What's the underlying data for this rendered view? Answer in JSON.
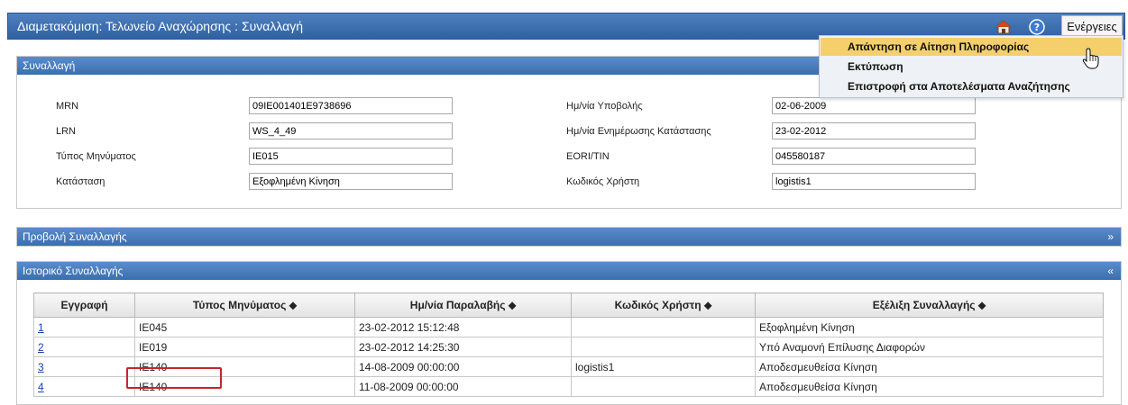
{
  "window": {
    "title": "Διαμετακόμιση: Τελωνείο Αναχώρησης : Συναλλαγή",
    "actions_label": "Ενέργειες",
    "icons": [
      "home-icon",
      "help-icon"
    ]
  },
  "menu": {
    "items": [
      {
        "label": "Απάντηση σε Αίτηση Πληροφορίας",
        "highlighted": true
      },
      {
        "label": "Εκτύπωση",
        "highlighted": false
      },
      {
        "label": "Επιστροφή στα Αποτελέσματα Αναζήτησης",
        "highlighted": false
      }
    ]
  },
  "transaction": {
    "header": "Συναλλαγή",
    "left": [
      {
        "label": "MRN",
        "value": "09IE001401E9738696"
      },
      {
        "label": "LRN",
        "value": "WS_4_49"
      },
      {
        "label": "Τύπος Μηνύματος",
        "value": "IE015"
      },
      {
        "label": "Κατάσταση",
        "value": "Εξοφλημένη Κίνηση"
      }
    ],
    "right": [
      {
        "label": "Ημ/νία Υποβολής",
        "value": "02-06-2009"
      },
      {
        "label": "Ημ/νία Ενημέρωσης Κατάστασης",
        "value": "23-02-2012"
      },
      {
        "label": "EORI/TIN",
        "value": "045580187"
      },
      {
        "label": "Κωδικός Χρήστη",
        "value": "logistis1"
      }
    ]
  },
  "view_panel": {
    "header": "Προβολή Συναλλαγής",
    "chevron": "»"
  },
  "history": {
    "header": "Ιστορικό Συναλλαγής",
    "chevron": "«",
    "columns": [
      "Εγγραφή",
      "Τύπος Μηνύματος ⬥",
      "Ημ/νία Παραλαβής ⬥",
      "Κωδικός Χρήστη ⬥",
      "Εξέλιξη Συναλλαγής ⬥"
    ],
    "rows": [
      {
        "id": "1",
        "type": "IE045",
        "date": "23-02-2012 15:12:48",
        "user": "",
        "status": "Εξοφλημένη Κίνηση"
      },
      {
        "id": "2",
        "type": "IE019",
        "date": "23-02-2012 14:25:30",
        "user": "",
        "status": "Υπό Αναμονή Επίλυσης Διαφορών"
      },
      {
        "id": "3",
        "type": "IE140",
        "date": "14-08-2009 00:00:00",
        "user": "logistis1",
        "status": "Αποδεσμευθείσα Κίνηση"
      },
      {
        "id": "4",
        "type": "IE140",
        "date": "11-08-2009 00:00:00",
        "user": "",
        "status": "Αποδεσμευθείσα Κίνηση"
      }
    ]
  }
}
